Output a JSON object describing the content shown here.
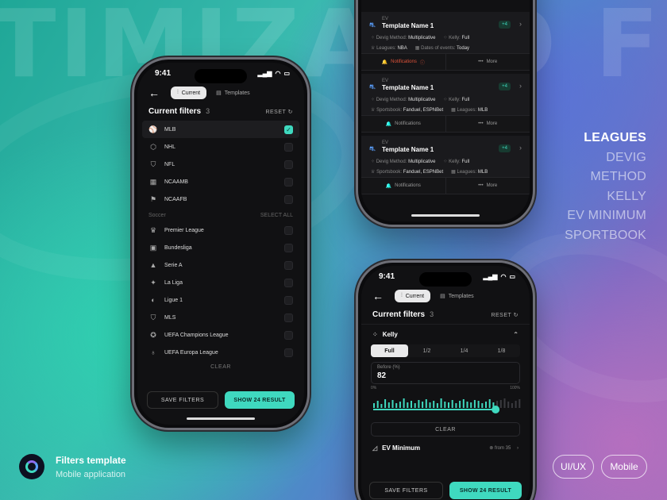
{
  "background_word": "TIMIZATIO      FILTI",
  "legend": [
    "LEAGUES",
    "DEVIG",
    "METHOD",
    "KELLY",
    "EV MINIMUM",
    "SPORTBOOK"
  ],
  "brand": {
    "title": "Filters template",
    "subtitle": "Mobile application"
  },
  "tags": [
    "UI/UX",
    "Mobile"
  ],
  "colors": {
    "accent": "#3fd9bf",
    "danger": "#e0533a"
  },
  "phone1": {
    "time": "9:41",
    "tab_current": "Current",
    "tab_templates": "Templates",
    "header": {
      "title": "Current filters",
      "count": "3",
      "reset": "RESET"
    },
    "leagues": [
      {
        "label": "MLB",
        "icon": "mlb-icon",
        "checked": true
      },
      {
        "label": "NHL",
        "icon": "nhl-icon",
        "checked": false
      },
      {
        "label": "NFL",
        "icon": "nfl-icon",
        "checked": false
      },
      {
        "label": "NCAAMB",
        "icon": "ncaamb-icon",
        "checked": false
      },
      {
        "label": "NCAAFB",
        "icon": "ncaafb-icon",
        "checked": false
      }
    ],
    "soccer_section": {
      "title": "Soccer",
      "select_all": "SELECT ALL"
    },
    "soccer": [
      {
        "label": "Premier League"
      },
      {
        "label": "Bundesliga"
      },
      {
        "label": "Serie A"
      },
      {
        "label": "La Liga"
      },
      {
        "label": "Ligue 1"
      },
      {
        "label": "MLS"
      },
      {
        "label": "UEFA Champions League"
      },
      {
        "label": "UEFA Europa League"
      }
    ],
    "clear": "CLEAR",
    "save": "SAVE FILTERS",
    "show": "SHOW 24 RESULT"
  },
  "phone2": {
    "cards": [
      {
        "ev": "EV",
        "name": "Template Name 1",
        "badge": "+4",
        "m1k": "Devig Method:",
        "m1v": "Multiplicative",
        "m2k": "Kelly:",
        "m2v": "Full",
        "m3k": "Leagues:",
        "m3v": "NBA",
        "m4k": "Dates of events:",
        "m4v": "Today",
        "notif": "Notifications",
        "more": "More"
      },
      {
        "ev": "EV",
        "name": "Template Name 1",
        "badge": "+4",
        "m1k": "Devig Method:",
        "m1v": "Multiplicative",
        "m2k": "Kelly:",
        "m2v": "Full",
        "m3k": "Sportsbook:",
        "m3v": "Fanduel, ESPNBet",
        "m4k": "Leagues:",
        "m4v": "MLB",
        "notif": "Notifications",
        "more": "More"
      },
      {
        "ev": "EV",
        "name": "Template Name 1",
        "badge": "+4",
        "m1k": "Devig Method:",
        "m1v": "Multiplicative",
        "m2k": "Kelly:",
        "m2v": "Full",
        "m3k": "Sportsbook:",
        "m3v": "Fanduel, ESPNBet",
        "m4k": "Leagues:",
        "m4v": "MLB",
        "notif": "Notifications",
        "more": "More"
      }
    ]
  },
  "phone3": {
    "time": "9:41",
    "tab_current": "Current",
    "tab_templates": "Templates",
    "header": {
      "title": "Current filters",
      "count": "3",
      "reset": "RESET"
    },
    "kelly": "Kelly",
    "kelly_options": [
      "Full",
      "1/2",
      "1/4",
      "1/8"
    ],
    "kelly_selected": "Full",
    "before_label": "Before (%)",
    "before_value": "82",
    "range_min": "0%",
    "range_max": "100%",
    "slider_value": 0.82,
    "clear": "CLEAR",
    "ev_min": "EV Minimum",
    "ev_from": "from 35",
    "save": "SAVE FILTERS",
    "show": "SHOW 24 RESULT"
  }
}
